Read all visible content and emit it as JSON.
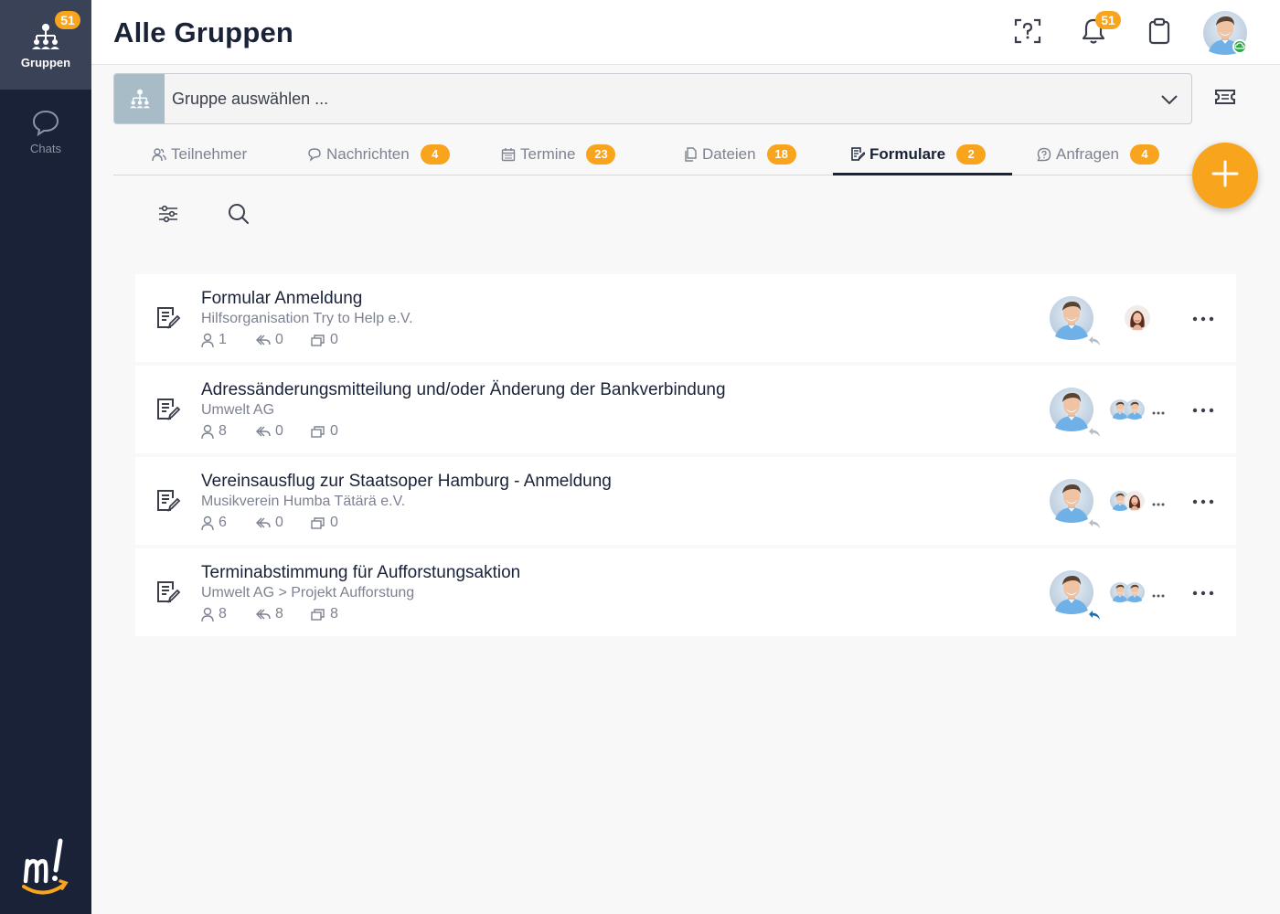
{
  "sidebar": {
    "items": [
      {
        "label": "Gruppen",
        "badge": "51",
        "icon": "groups-icon",
        "active": true
      },
      {
        "label": "Chats",
        "icon": "chat-bubble-icon",
        "active": false
      }
    ],
    "logo_text": "m!"
  },
  "header": {
    "title": "Alle Gruppen",
    "notification_badge": "51",
    "icons": [
      "help-scan-icon",
      "bell-icon",
      "clipboard-icon",
      "user-avatar"
    ]
  },
  "group_selector": {
    "placeholder": "Gruppe auswählen ..."
  },
  "tabs": [
    {
      "label": "Teilnehmer",
      "badge": "",
      "icon": "people-icon"
    },
    {
      "label": "Nachrichten",
      "badge": "4",
      "icon": "speech-bubble-icon"
    },
    {
      "label": "Termine",
      "badge": "23",
      "icon": "calendar-icon"
    },
    {
      "label": "Dateien",
      "badge": "18",
      "icon": "files-icon"
    },
    {
      "label": "Formulare",
      "badge": "2",
      "icon": "form-icon",
      "active": true
    },
    {
      "label": "Anfragen",
      "badge": "4",
      "icon": "question-bubble-icon"
    }
  ],
  "forms": [
    {
      "title": "Formular Anmeldung",
      "subtitle": "Hilfsorganisation Try to Help e.V.",
      "participants": "1",
      "replies": "0",
      "copies": "0",
      "reply_active": false,
      "assignees": "single"
    },
    {
      "title": "Adressänderungsmitteilung und/oder Änderung der Bankverbindung",
      "subtitle": "Umwelt AG",
      "participants": "8",
      "replies": "0",
      "copies": "0",
      "reply_active": false,
      "assignees": "group"
    },
    {
      "title": "Vereinsausflug zur Staatsoper Hamburg - Anmeldung",
      "subtitle": "Musikverein Humba Tätärä e.V.",
      "participants": "6",
      "replies": "0",
      "copies": "0",
      "reply_active": false,
      "assignees": "group"
    },
    {
      "title": "Terminabstimmung für Aufforstungsaktion",
      "subtitle": "Umwelt AG > Projekt Aufforstung",
      "participants": "8",
      "replies": "8",
      "copies": "8",
      "reply_active": true,
      "assignees": "group"
    }
  ],
  "colors": {
    "sidebar_bg": "#1a2238",
    "sidebar_active": "#3a4257",
    "accent": "#f8a41c",
    "text_dark": "#1a2238",
    "text_muted": "#7d8290",
    "reply_blue": "#1f6fb5"
  }
}
